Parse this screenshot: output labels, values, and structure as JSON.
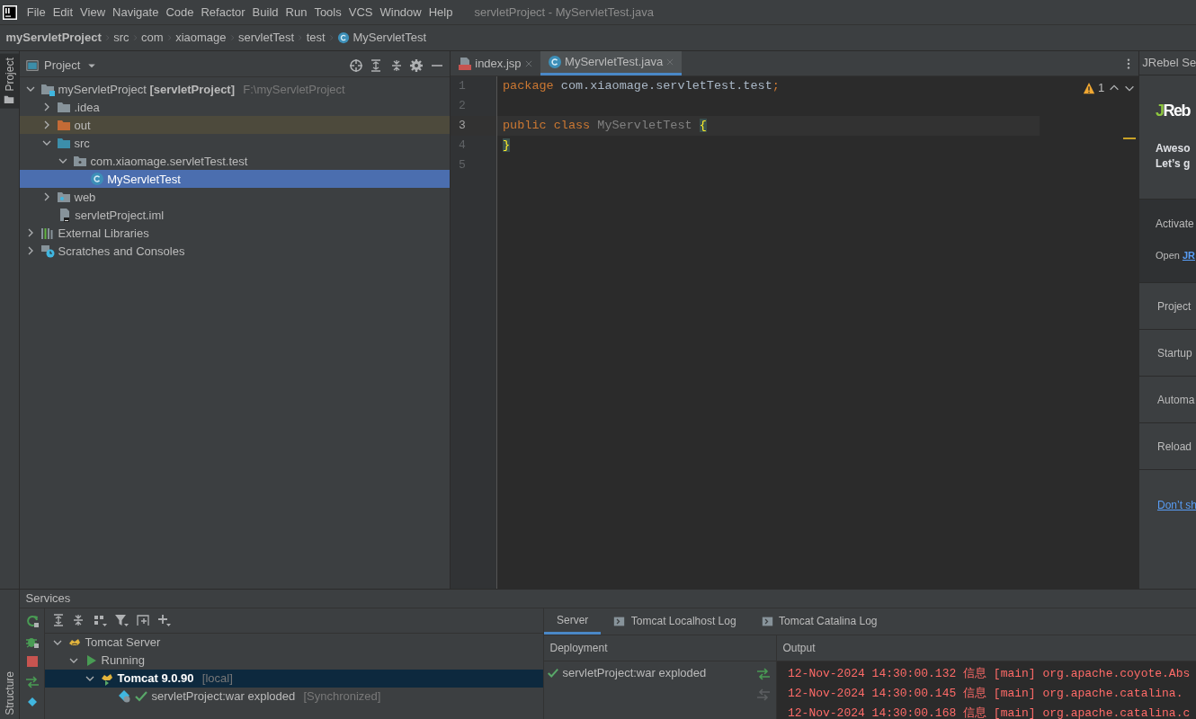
{
  "menu_bar": {
    "items": [
      "File",
      "Edit",
      "View",
      "Navigate",
      "Code",
      "Refactor",
      "Build",
      "Run",
      "Tools",
      "VCS",
      "Window",
      "Help"
    ],
    "title": "servletProject - MyServletTest.java"
  },
  "breadcrumb": [
    {
      "label": "myServletProject",
      "kind": "project"
    },
    {
      "label": "src",
      "kind": "folder"
    },
    {
      "label": "com",
      "kind": "folder"
    },
    {
      "label": "xiaomage",
      "kind": "folder"
    },
    {
      "label": "servletTest",
      "kind": "folder"
    },
    {
      "label": "test",
      "kind": "folder"
    },
    {
      "label": "MyServletTest",
      "kind": "class"
    }
  ],
  "side_tabs": [
    {
      "label": "Project",
      "kind": "project",
      "selected": true
    },
    {
      "label": "Structure",
      "kind": "structure",
      "selected": false
    }
  ],
  "project_panel": {
    "title": "Project",
    "tree": [
      {
        "label": "myServletProject **[servletProject]**",
        "path": "F:\\myServletProject",
        "kind": "module",
        "expanded": true,
        "selected": false,
        "children": [
          {
            "label": ".idea",
            "kind": "folder",
            "expanded": false,
            "selected": false
          },
          {
            "label": "out",
            "kind": "excluded_folder",
            "expanded": false,
            "selected": false
          },
          {
            "label": "src",
            "kind": "source_folder",
            "expanded": true,
            "selected": false,
            "children": [
              {
                "label": "com.xiaomage.servletTest.test",
                "kind": "package",
                "expanded": true,
                "selected": false,
                "children": [
                  {
                    "label": "MyServletTest",
                    "kind": "class",
                    "selected": true
                  }
                ]
              }
            ]
          },
          {
            "label": "web",
            "kind": "web_folder",
            "expanded": false,
            "selected": false
          },
          {
            "label": "servletProject.iml",
            "kind": "iml_file",
            "selected": false
          }
        ]
      },
      {
        "label": "External Libraries",
        "kind": "libraries",
        "expanded": false,
        "selected": false
      },
      {
        "label": "Scratches and Consoles",
        "kind": "scratches",
        "expanded": false,
        "selected": false
      }
    ]
  },
  "editor": {
    "tabs": [
      {
        "label": "index.jsp",
        "kind": "jsp",
        "selected": false
      },
      {
        "label": "MyServletTest.java",
        "kind": "class",
        "selected": true
      }
    ],
    "warning_count": "1",
    "lines": [
      {
        "number": "1",
        "current": false,
        "tokens": [
          {
            "text": "package",
            "kind": "keyword"
          },
          {
            "text": " com.xiaomage.servletTest.test",
            "kind": "plain"
          },
          {
            "text": ";",
            "kind": "keyword"
          }
        ]
      },
      {
        "number": "2",
        "current": false
      },
      {
        "number": "3",
        "current": true,
        "tokens": [
          {
            "text": "public class",
            "kind": "keyword"
          },
          {
            "text": " MyServletTest ",
            "kind": "unused"
          },
          {
            "text": "{",
            "kind": "brace"
          }
        ]
      },
      {
        "number": "4",
        "current": false,
        "tokens": [
          {
            "text": "}",
            "kind": "brace"
          }
        ]
      },
      {
        "number": "5",
        "current": false
      }
    ]
  },
  "jrebel_panel": {
    "title": "JRebel Se",
    "logo_accent": "J",
    "logo_rest": "Reb",
    "sections": [
      {
        "kind": "intro",
        "lines": [
          "Aweso",
          "Let’s g"
        ]
      },
      {
        "kind": "activation",
        "text": "Activate",
        "link_prefix": "Open",
        "link": "JR"
      },
      {
        "kind": "item",
        "text": "Project"
      },
      {
        "kind": "item",
        "text": "Startup"
      },
      {
        "kind": "item",
        "text": "Automa"
      },
      {
        "kind": "item",
        "text": "Reload"
      },
      {
        "kind": "footer",
        "link": "Don’t sh"
      }
    ]
  },
  "services": {
    "title": "Services",
    "tree": [
      {
        "label": "Tomcat Server",
        "kind": "server",
        "expanded": true,
        "selected": false,
        "children": [
          {
            "label": "Running",
            "kind": "running",
            "expanded": true,
            "selected": false,
            "children": [
              {
                "label": "Tomcat 9.0.90",
                "hint": "[local]",
                "kind": "instance",
                "expanded": true,
                "selected": true,
                "children": [
                  {
                    "label": "servletProject:war exploded",
                    "hint": "[Synchronized]",
                    "kind": "artifact",
                    "selected": false
                  }
                ]
              }
            ]
          }
        ]
      }
    ],
    "tabs": [
      {
        "label": "Server",
        "kind": "plain",
        "selected": true
      },
      {
        "label": "Tomcat Localhost Log",
        "kind": "log",
        "selected": false
      },
      {
        "label": "Tomcat Catalina Log",
        "kind": "log",
        "selected": false
      }
    ],
    "deployment_header": "Deployment",
    "output_header": "Output",
    "deployments": [
      {
        "label": "servletProject:war exploded",
        "deployed": true
      }
    ],
    "output": [
      "12-Nov-2024 14:30:00.132 信息 [main] org.apache.coyote.Abs",
      "12-Nov-2024 14:30:00.145 信息 [main] org.apache.catalina.",
      "12-Nov-2024 14:30:00.168 信息 [main] org.apache.catalina.c"
    ]
  }
}
